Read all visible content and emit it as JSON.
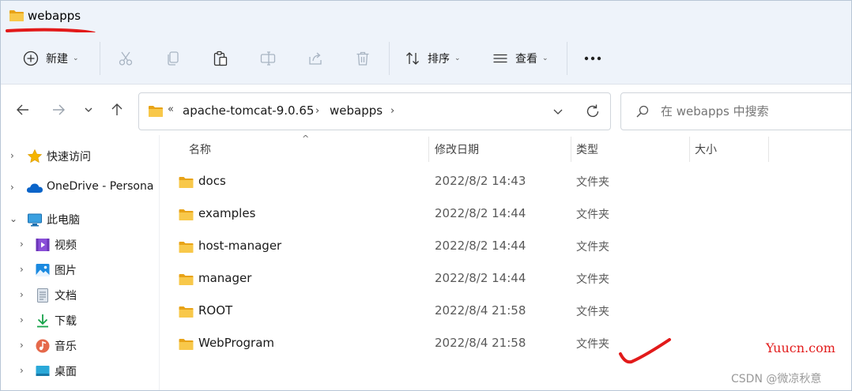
{
  "window": {
    "title": "webapps"
  },
  "commandbar": {
    "new_label": "新建",
    "sort_label": "排序",
    "view_label": "查看",
    "more_label": "..."
  },
  "address": {
    "overflow": "«",
    "crumbs": [
      "apache-tomcat-9.0.65",
      "webapps"
    ],
    "search_placeholder": "在 webapps 中搜索"
  },
  "nav": {
    "items": [
      {
        "label": "快速访问",
        "icon": "star-icon"
      },
      {
        "label": "OneDrive - Persona",
        "icon": "cloud-icon"
      },
      {
        "label": "此电脑",
        "icon": "pc-icon"
      },
      {
        "label": "视频",
        "icon": "video-icon"
      },
      {
        "label": "图片",
        "icon": "picture-icon"
      },
      {
        "label": "文档",
        "icon": "document-icon"
      },
      {
        "label": "下载",
        "icon": "download-icon"
      },
      {
        "label": "音乐",
        "icon": "music-icon"
      },
      {
        "label": "桌面",
        "icon": "desktop-icon"
      }
    ]
  },
  "columns": {
    "name": "名称",
    "date": "修改日期",
    "type": "类型",
    "size": "大小"
  },
  "files": [
    {
      "name": "docs",
      "date": "2022/8/2 14:43",
      "type": "文件夹"
    },
    {
      "name": "examples",
      "date": "2022/8/2 14:44",
      "type": "文件夹"
    },
    {
      "name": "host-manager",
      "date": "2022/8/2 14:44",
      "type": "文件夹"
    },
    {
      "name": "manager",
      "date": "2022/8/2 14:44",
      "type": "文件夹"
    },
    {
      "name": "ROOT",
      "date": "2022/8/4 21:58",
      "type": "文件夹"
    },
    {
      "name": "WebProgram",
      "date": "2022/8/4 21:58",
      "type": "文件夹"
    }
  ],
  "watermarks": {
    "site": "Yuucn.com",
    "csdn": "CSDN @微凉秋意"
  },
  "colors": {
    "folder": "#f5c24a",
    "accent": "#0067c0",
    "annotation": "#e21a1a",
    "titlebar": "#eef3fa"
  }
}
